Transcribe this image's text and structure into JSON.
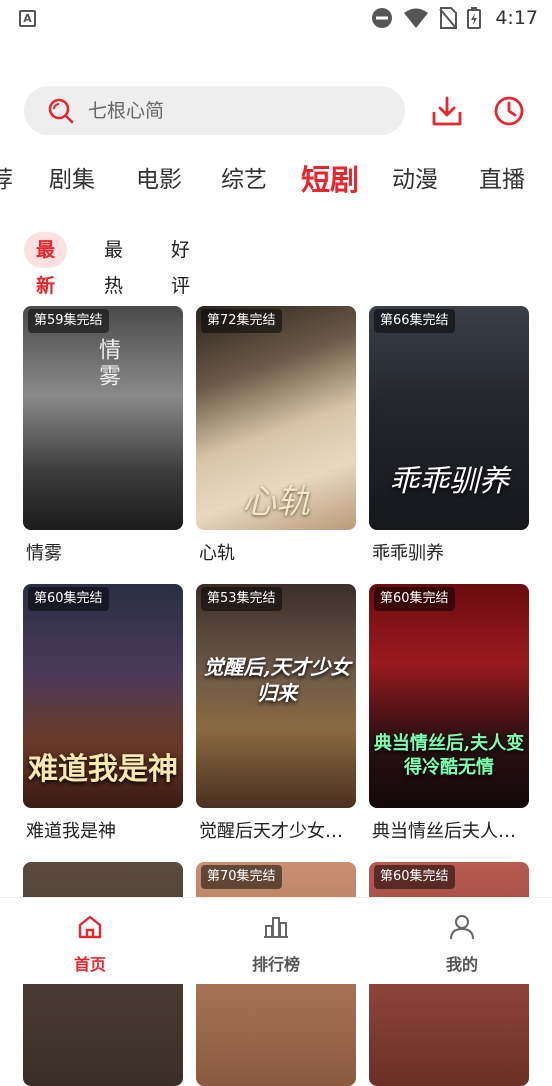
{
  "status_bar": {
    "time": "4:17",
    "app_icon_letter": "A"
  },
  "search": {
    "placeholder": "七根心简"
  },
  "colors": {
    "accent": "#e8262b",
    "accent_bg": "#fde1e1",
    "text": "#222222"
  },
  "category_tabs": [
    {
      "label": "荐"
    },
    {
      "label": "剧集"
    },
    {
      "label": "电影"
    },
    {
      "label": "综艺"
    },
    {
      "label": "短剧",
      "active": true
    },
    {
      "label": "动漫"
    },
    {
      "label": "直播"
    }
  ],
  "sub_tabs": [
    {
      "label": "最新",
      "active": true
    },
    {
      "label": "最热"
    },
    {
      "label": "好评"
    }
  ],
  "cards": [
    {
      "badge": "第59集完结",
      "title": "情雾",
      "poster_text": "情雾"
    },
    {
      "badge": "第72集完结",
      "title": "心轨",
      "poster_text": "心轨"
    },
    {
      "badge": "第66集完结",
      "title": "乖乖驯养",
      "poster_text": "乖乖驯养"
    },
    {
      "badge": "第60集完结",
      "title": "难道我是神",
      "poster_text": "难道我是神"
    },
    {
      "badge": "第53集完结",
      "title": "觉醒后天才少女归来",
      "poster_text": "觉醒后,天才少女归来"
    },
    {
      "badge": "第60集完结",
      "title": "典当情丝后夫人变得冷酷无情",
      "poster_text": "典当情丝后,夫人变得冷酷无情"
    },
    {
      "badge": "",
      "title": "",
      "poster_text": ""
    },
    {
      "badge": "第70集完结",
      "title": "",
      "poster_text": ""
    },
    {
      "badge": "第60集完结",
      "title": "",
      "poster_text": ""
    }
  ],
  "bottom_nav": [
    {
      "label": "首页",
      "icon": "home-icon",
      "active": true
    },
    {
      "label": "排行榜",
      "icon": "chart-icon"
    },
    {
      "label": "我的",
      "icon": "user-icon"
    }
  ]
}
